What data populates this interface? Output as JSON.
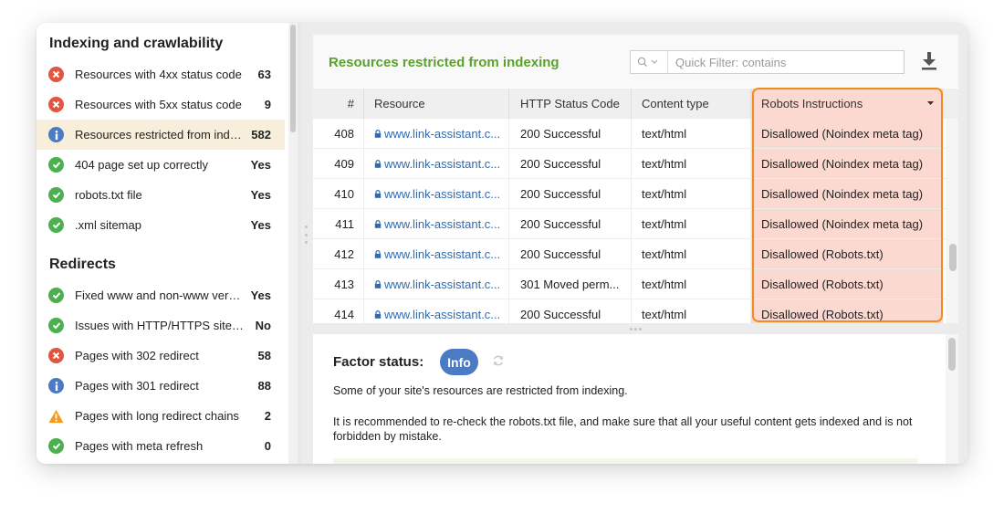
{
  "sidebar": {
    "sections": [
      {
        "title": "Indexing and crawlability",
        "items": [
          {
            "status": "error",
            "icon": "error-icon",
            "label": "Resources with 4xx status code",
            "value": "63"
          },
          {
            "status": "error",
            "icon": "error-icon",
            "label": "Resources with 5xx status code",
            "value": "9"
          },
          {
            "status": "info",
            "icon": "info-icon",
            "label": "Resources restricted from indexing",
            "label_display": "Resources restricted from indexi...",
            "value": "582",
            "active": true
          },
          {
            "status": "ok",
            "icon": "check-icon",
            "label": "404 page set up correctly",
            "value": "Yes"
          },
          {
            "status": "ok",
            "icon": "check-icon",
            "label": "robots.txt file",
            "value": "Yes"
          },
          {
            "status": "ok",
            "icon": "check-icon",
            "label": ".xml sitemap",
            "value": "Yes"
          }
        ]
      },
      {
        "title": "Redirects",
        "items": [
          {
            "status": "ok",
            "icon": "check-icon",
            "label": "Fixed www and non-www versions",
            "value": "Yes"
          },
          {
            "status": "ok",
            "icon": "check-icon",
            "label": "Issues with HTTP/HTTPS site versions",
            "label_display": "Issues with HTTP/HTTPS site ver...",
            "value": "No"
          },
          {
            "status": "error",
            "icon": "error-icon",
            "label": "Pages with 302 redirect",
            "value": "58"
          },
          {
            "status": "info",
            "icon": "info-icon",
            "label": "Pages with 301 redirect",
            "value": "88"
          },
          {
            "status": "warn",
            "icon": "warning-icon",
            "label": "Pages with long redirect chains",
            "value": "2"
          },
          {
            "status": "ok",
            "icon": "check-icon",
            "label": "Pages with meta refresh",
            "value": "0"
          }
        ]
      }
    ]
  },
  "panel": {
    "title": "Resources restricted from indexing",
    "filter": {
      "placeholder": "Quick Filter: contains",
      "value": ""
    },
    "download_icon": "download-icon"
  },
  "table": {
    "columns": [
      "#",
      "Resource",
      "HTTP Status Code",
      "Content type",
      "Robots Instructions"
    ],
    "sorted_column": "Robots Instructions",
    "rows": [
      {
        "num": "408",
        "resource": "www.link-assistant.c...",
        "http": "200 Successful",
        "content_type": "text/html",
        "robots": "Disallowed (Noindex meta tag)"
      },
      {
        "num": "409",
        "resource": "www.link-assistant.c...",
        "http": "200 Successful",
        "content_type": "text/html",
        "robots": "Disallowed (Noindex meta tag)"
      },
      {
        "num": "410",
        "resource": "www.link-assistant.c...",
        "http": "200 Successful",
        "content_type": "text/html",
        "robots": "Disallowed (Noindex meta tag)"
      },
      {
        "num": "411",
        "resource": "www.link-assistant.c...",
        "http": "200 Successful",
        "content_type": "text/html",
        "robots": "Disallowed (Noindex meta tag)"
      },
      {
        "num": "412",
        "resource": "www.link-assistant.c...",
        "http": "200 Successful",
        "content_type": "text/html",
        "robots": "Disallowed (Robots.txt)"
      },
      {
        "num": "413",
        "resource": "www.link-assistant.c...",
        "http": "301 Moved perm...",
        "content_type": "text/html",
        "robots": "Disallowed (Robots.txt)"
      },
      {
        "num": "414",
        "resource": "www.link-assistant.c...",
        "http": "200 Successful",
        "content_type": "text/html",
        "robots": "Disallowed (Robots.txt)"
      }
    ]
  },
  "factor": {
    "label": "Factor status:",
    "status": "Info",
    "text1": "Some of your site's resources are restricted from indexing.",
    "text2": "It is recommended to re-check the robots.txt file, and make sure that all your useful content gets indexed and is not forbidden by mistake."
  },
  "colors": {
    "accent_green": "#5ba12b",
    "info_blue": "#4a7bc4",
    "error_red": "#e3553f",
    "ok_green": "#4caf50",
    "warn_orange": "#f29b1d",
    "highlight_orange": "#f08c1f",
    "robots_cell_bg": "#fcd9d0",
    "active_item_bg": "#f7efdc",
    "link_blue": "#2f6ab0"
  }
}
